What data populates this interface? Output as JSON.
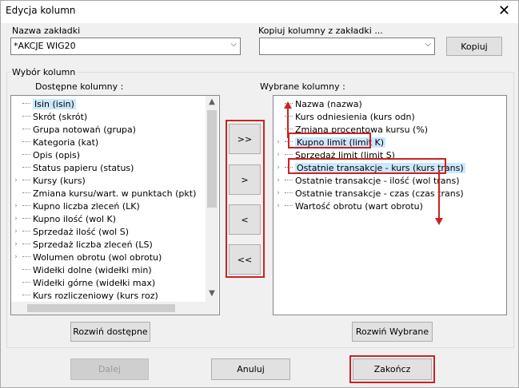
{
  "title": "Edycja kolumn",
  "tab_name": {
    "label": "Nazwa zakładki",
    "value": "*AKCJE WIG20"
  },
  "copy": {
    "label": "Kopiuj kolumny z zakładki ...",
    "value": "",
    "button": "Kopiuj"
  },
  "group_label": "Wybór kolumn",
  "available": {
    "label": "Dostępne kolumny :",
    "items": [
      {
        "text": "Isin (isin)",
        "expand": false,
        "selected": true
      },
      {
        "text": "Skrót (skrót)",
        "expand": false
      },
      {
        "text": "Grupa notowań (grupa)",
        "expand": false
      },
      {
        "text": "Kategoria (kat)",
        "expand": false
      },
      {
        "text": "Opis (opis)",
        "expand": false
      },
      {
        "text": "Status papieru (status)",
        "expand": false
      },
      {
        "text": "Kursy (kurs)",
        "expand": true
      },
      {
        "text": "Zmiana kursu/wart. w punktach (pkt)",
        "expand": false
      },
      {
        "text": "Kupno liczba zleceń (LK)",
        "expand": true
      },
      {
        "text": "Kupno ilość (wol K)",
        "expand": true
      },
      {
        "text": "Sprzedaż ilość (wol S)",
        "expand": true
      },
      {
        "text": "Sprzedaż liczba zleceń (LS)",
        "expand": true
      },
      {
        "text": "Wolumen obrotu (wol obrotu)",
        "expand": true
      },
      {
        "text": "Widełki dolne (widełki min)",
        "expand": false
      },
      {
        "text": "Widełki górne (widełki max)",
        "expand": false
      },
      {
        "text": "Kurs rozliczeniowy (kurs roz)",
        "expand": false
      }
    ],
    "expand_button": "Rozwiń dostępne"
  },
  "selected": {
    "label": "Wybrane kolumny :",
    "items": [
      {
        "text": "Nazwa (nazwa)",
        "expand": false
      },
      {
        "text": "Kurs odniesienia (kurs odn)",
        "expand": false
      },
      {
        "text": "Zmiana procentowa kursu (%)",
        "expand": false
      },
      {
        "text": "Kupno limit (limit K)",
        "expand": true,
        "selected": true
      },
      {
        "text": "Sprzedaż limit (limit S)",
        "expand": true
      },
      {
        "text": "Ostatnie transakcje - kurs (kurs trans)",
        "expand": true,
        "selected": true
      },
      {
        "text": "Ostatnie transakcje - ilość (wol trans)",
        "expand": true
      },
      {
        "text": "Ostatnie transakcje - czas (czas trans)",
        "expand": true
      },
      {
        "text": "Wartość obrotu (wart obrotu)",
        "expand": true
      }
    ],
    "expand_button": "Rozwiń Wybrane"
  },
  "move_buttons": {
    "add_all": ">>",
    "add": ">",
    "remove": "<",
    "remove_all": "<<"
  },
  "footer": {
    "next": "Dalej",
    "cancel": "Anuluj",
    "finish": "Zakończ"
  },
  "colors": {
    "highlight": "#cc2222",
    "selection": "#cce8ff"
  }
}
